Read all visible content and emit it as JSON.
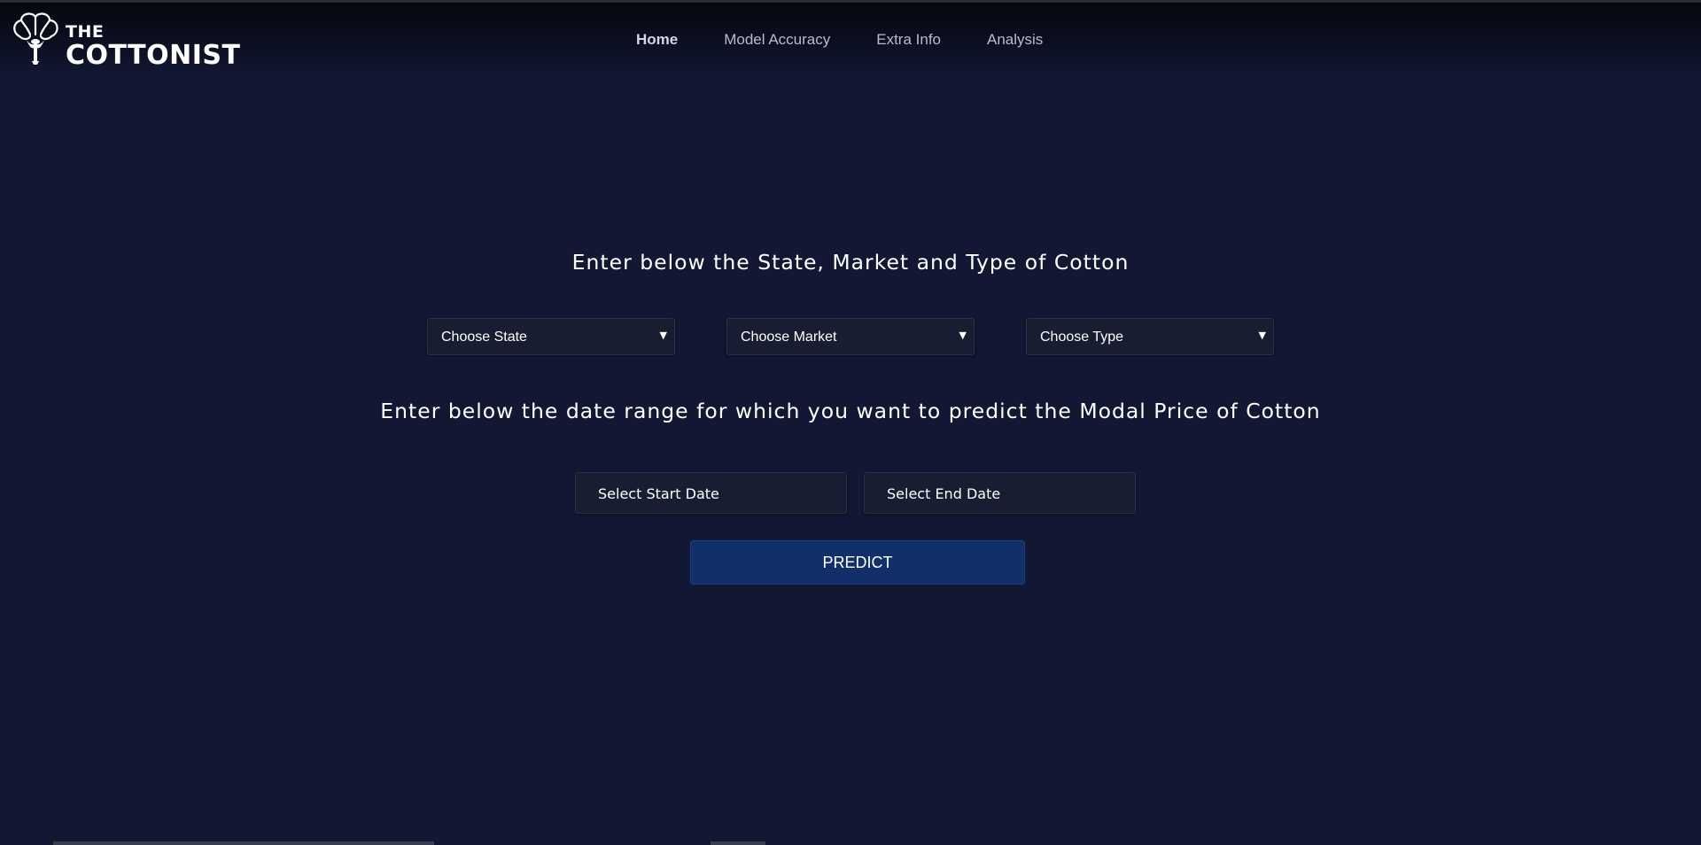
{
  "brand": {
    "line1": "THE",
    "line2": "COTTONIST",
    "logo_icon": "cotton-flower-icon"
  },
  "nav": {
    "items": [
      {
        "label": "Home",
        "active": true
      },
      {
        "label": "Model Accuracy",
        "active": false
      },
      {
        "label": "Extra Info",
        "active": false
      },
      {
        "label": "Analysis",
        "active": false
      }
    ]
  },
  "form": {
    "heading1": "Enter below the State, Market and Type of Cotton",
    "selects": {
      "state": "Choose State",
      "market": "Choose Market",
      "type": "Choose Type"
    },
    "heading2": "Enter below the date range for which you want to predict the Modal Price of Cotton",
    "start_date_placeholder": "Select Start Date",
    "end_date_placeholder": "Select End Date",
    "predict_label": "PREDICT"
  },
  "colors": {
    "background": "#121833",
    "button": "#11306a",
    "text": "#ffffff"
  }
}
